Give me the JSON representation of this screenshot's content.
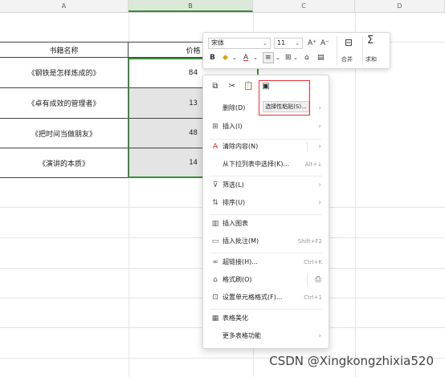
{
  "columns": [
    "A",
    "B",
    "C",
    "D"
  ],
  "table": {
    "headers": [
      "书籍名称",
      "价格"
    ],
    "rows": [
      {
        "name": "《钢铁是怎样炼成的》",
        "price": "84"
      },
      {
        "name": "《卓有成效的管理者》",
        "price": "13"
      },
      {
        "name": "《把时间当做朋友》",
        "price": "48"
      },
      {
        "name": "《演讲的本质》",
        "price": "14"
      }
    ]
  },
  "mini_toolbar": {
    "font": "宋体",
    "size": "11",
    "merge_label": "合并",
    "sum_label": "求和",
    "bold": "B",
    "grow": "A⁺",
    "shrink": "A⁻"
  },
  "context_menu": {
    "paste_special_tooltip": "选择性粘贴(S)...",
    "items": [
      {
        "label": "删除(D)",
        "shortcut": "",
        "submenu": true
      },
      {
        "label": "插入(I)",
        "shortcut": "",
        "submenu": true
      },
      {
        "label": "清除内容(N)",
        "shortcut": "",
        "submenu": true
      },
      {
        "label": "从下拉列表中选择(K)...",
        "shortcut": "Alt+↓",
        "submenu": false
      },
      {
        "label": "筛选(L)",
        "shortcut": "",
        "submenu": true
      },
      {
        "label": "排序(U)",
        "shortcut": "",
        "submenu": true
      },
      {
        "label": "插入图表",
        "shortcut": "",
        "submenu": false
      },
      {
        "label": "插入批注(M)",
        "shortcut": "Shift+F2",
        "submenu": false
      },
      {
        "label": "超链接(H)...",
        "shortcut": "Ctrl+K",
        "submenu": false
      },
      {
        "label": "格式刷(O)",
        "shortcut": "",
        "submenu": false
      },
      {
        "label": "设置单元格格式(F)...",
        "shortcut": "Ctrl+1",
        "submenu": false
      },
      {
        "label": "表格美化",
        "shortcut": "",
        "submenu": false
      },
      {
        "label": "更多表格功能",
        "shortcut": "",
        "submenu": true
      }
    ]
  },
  "watermark": "CSDN @Xingkongzhixia520",
  "colors": {
    "selection": "#3b8a3b",
    "highlight_border": "#e03333"
  }
}
